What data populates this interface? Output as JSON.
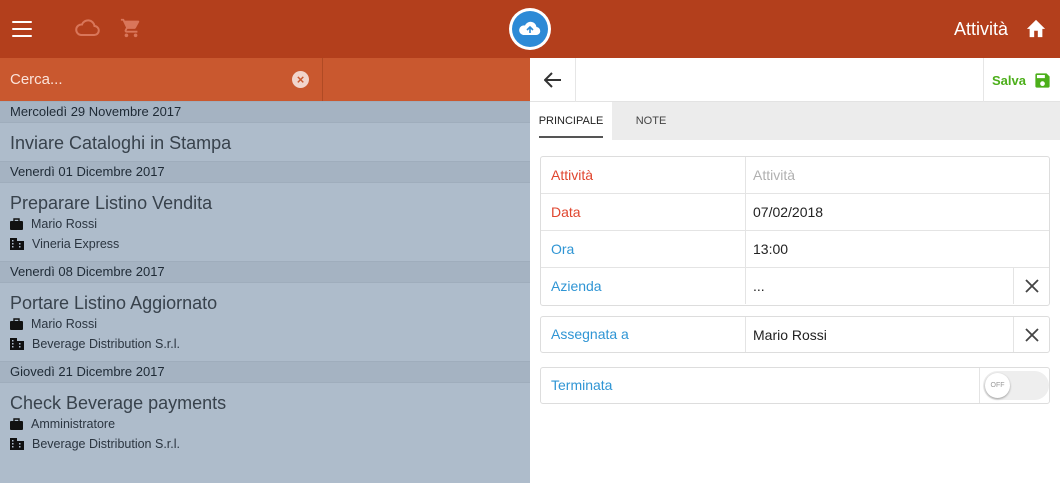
{
  "header": {
    "title": "Attività",
    "icons": {
      "menu": "hamburger-menu-icon",
      "cloud": "cloud-icon",
      "cart": "cart-icon",
      "home": "home-icon"
    },
    "colors": {
      "bar": "#b33f1c",
      "logo": "#2d8ad6"
    }
  },
  "search": {
    "placeholder": "Cerca...",
    "value": ""
  },
  "list": {
    "groups": [
      {
        "date": "Mercoledì 29 Novembre 2017",
        "items": [
          {
            "title": "Inviare Cataloghi in Stampa",
            "person": "",
            "company": ""
          }
        ]
      },
      {
        "date": "Venerdì 01 Dicembre 2017",
        "items": [
          {
            "title": "Preparare Listino Vendita",
            "person": "Mario Rossi",
            "company": "Vineria Express"
          }
        ]
      },
      {
        "date": "Venerdì 08 Dicembre 2017",
        "items": [
          {
            "title": "Portare Listino Aggiornato",
            "person": "Mario Rossi",
            "company": "Beverage Distribution S.r.l."
          }
        ]
      },
      {
        "date": "Giovedì 21 Dicembre 2017",
        "items": [
          {
            "title": "Check Beverage payments",
            "person": "Amministratore",
            "company": "Beverage Distribution S.r.l."
          }
        ]
      }
    ]
  },
  "detail": {
    "save_label": "Salva",
    "tabs": [
      {
        "label": "PRINCIPALE",
        "active": true
      },
      {
        "label": "NOTE",
        "active": false
      }
    ],
    "fields": {
      "attivita": {
        "label": "Attività",
        "placeholder": "Attività",
        "value": "",
        "required": true
      },
      "data": {
        "label": "Data",
        "value": "07/02/2018",
        "required": true
      },
      "ora": {
        "label": "Ora",
        "value": "13:00"
      },
      "azienda": {
        "label": "Azienda",
        "value": "..."
      },
      "assegnata": {
        "label": "Assegnata a",
        "value": "Mario Rossi"
      },
      "terminata": {
        "label": "Terminata",
        "toggle_label": "OFF",
        "checked": false
      }
    },
    "colors": {
      "save": "#4caf1a",
      "required": "#e0462f",
      "label": "#2f95d4"
    }
  }
}
